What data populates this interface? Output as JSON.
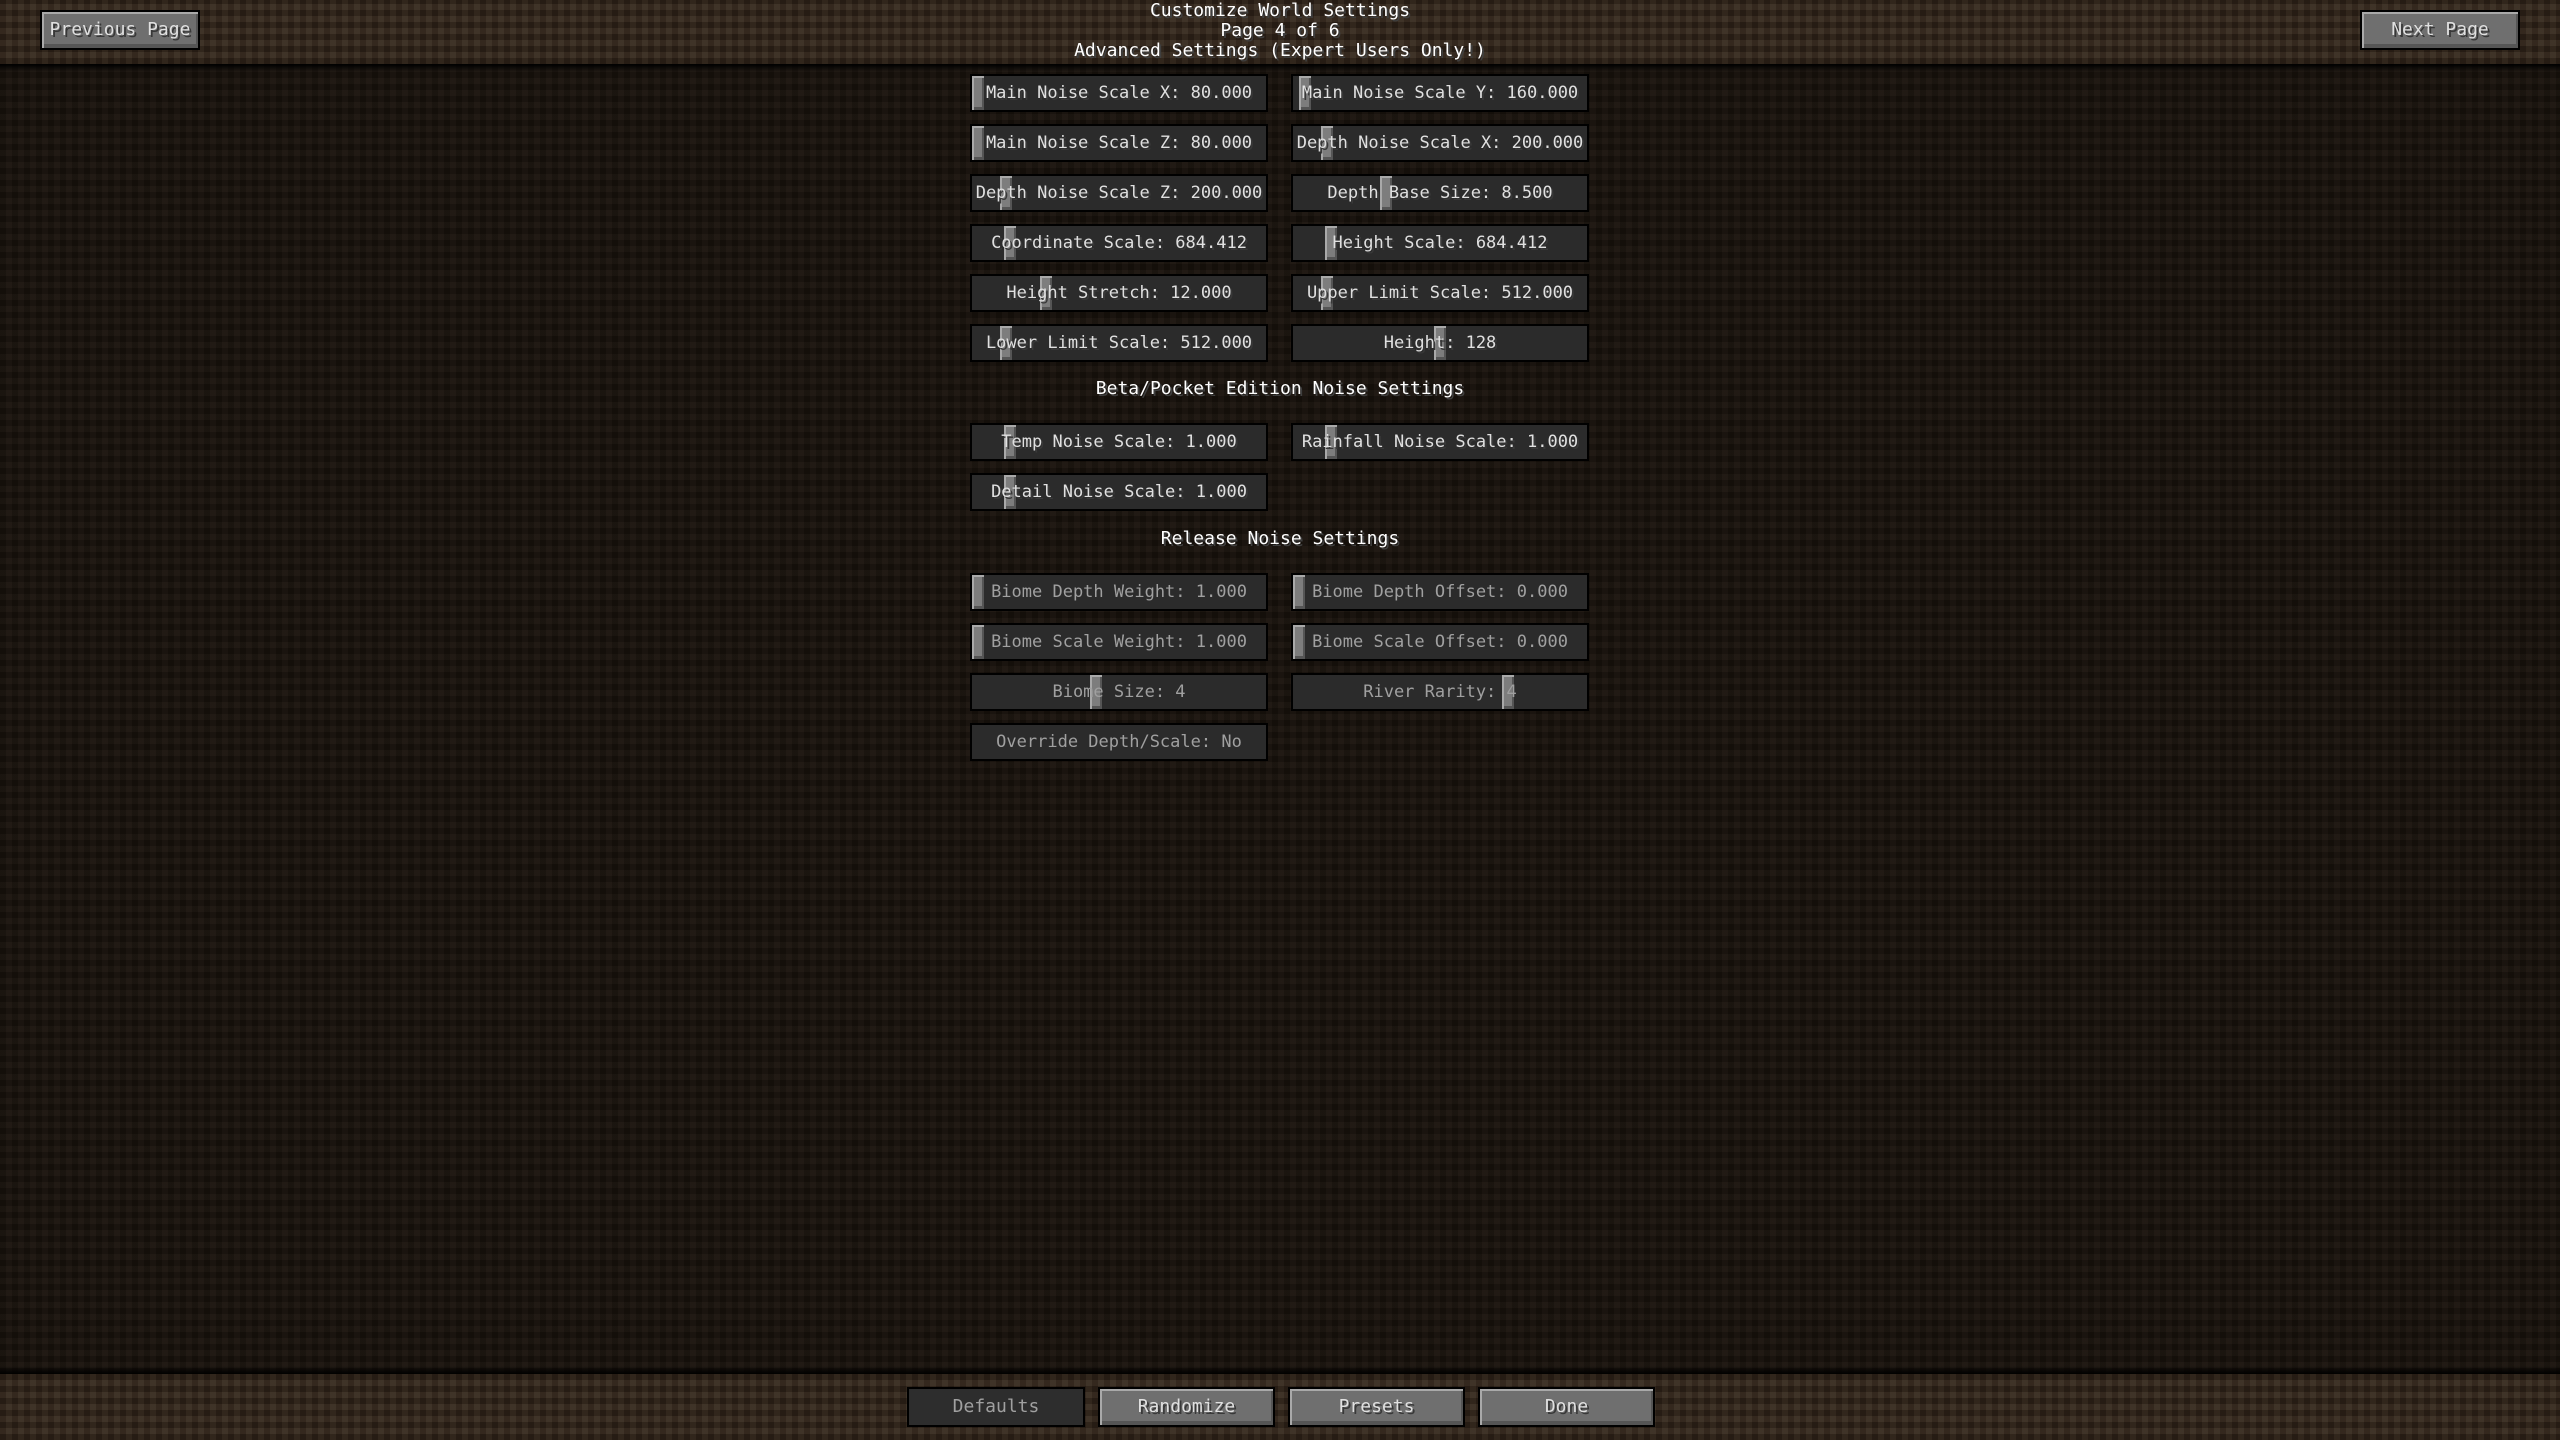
{
  "header": {
    "title": "Customize World Settings",
    "page_indicator": "Page 4 of 6",
    "subtitle": "Advanced Settings (Expert Users Only!)",
    "previous_page_label": "Previous Page",
    "next_page_label": "Next Page"
  },
  "sliders_main": [
    {
      "label": "Main Noise Scale X: 80.000",
      "position": 0.0,
      "enabled": true
    },
    {
      "label": "Main Noise Scale Y: 160.000",
      "position": 0.02,
      "enabled": true
    },
    {
      "label": "Main Noise Scale Z: 80.000",
      "position": 0.0,
      "enabled": true
    },
    {
      "label": "Depth Noise Scale X: 200.000",
      "position": 0.1,
      "enabled": true
    },
    {
      "label": "Depth Noise Scale Z: 200.000",
      "position": 0.1,
      "enabled": true
    },
    {
      "label": "Depth Base Size: 8.500",
      "position": 0.31,
      "enabled": true
    },
    {
      "label": "Coordinate Scale: 684.412",
      "position": 0.115,
      "enabled": true
    },
    {
      "label": "Height Scale: 684.412",
      "position": 0.115,
      "enabled": true
    },
    {
      "label": "Height Stretch: 12.000",
      "position": 0.24,
      "enabled": true
    },
    {
      "label": "Upper Limit Scale: 512.000",
      "position": 0.1,
      "enabled": true
    },
    {
      "label": "Lower Limit Scale: 512.000",
      "position": 0.1,
      "enabled": true
    },
    {
      "label": "Height: 128",
      "position": 0.5,
      "enabled": true
    }
  ],
  "beta_section": {
    "title": "Beta/Pocket Edition Noise Settings",
    "sliders": [
      {
        "label": "Temp Noise Scale: 1.000",
        "position": 0.115,
        "enabled": true
      },
      {
        "label": "Rainfall Noise Scale: 1.000",
        "position": 0.115,
        "enabled": true
      },
      {
        "label": "Detail Noise Scale: 1.000",
        "position": 0.115,
        "enabled": true
      }
    ]
  },
  "release_section": {
    "title": "Release Noise Settings",
    "sliders": [
      {
        "label": "Biome Depth Weight: 1.000",
        "position": 0.0,
        "enabled": false
      },
      {
        "label": "Biome Depth Offset: 0.000",
        "position": 0.0,
        "enabled": false
      },
      {
        "label": "Biome Scale Weight: 1.000",
        "position": 0.0,
        "enabled": false
      },
      {
        "label": "Biome Scale Offset: 0.000",
        "position": 0.0,
        "enabled": false
      },
      {
        "label": "Biome Size: 4",
        "position": 0.42,
        "enabled": false
      },
      {
        "label": "River Rarity: 4",
        "position": 0.74,
        "enabled": false
      }
    ],
    "override_button_label": "Override Depth/Scale: No"
  },
  "footer": {
    "defaults_label": "Defaults",
    "randomize_label": "Randomize",
    "presets_label": "Presets",
    "done_label": "Done"
  }
}
